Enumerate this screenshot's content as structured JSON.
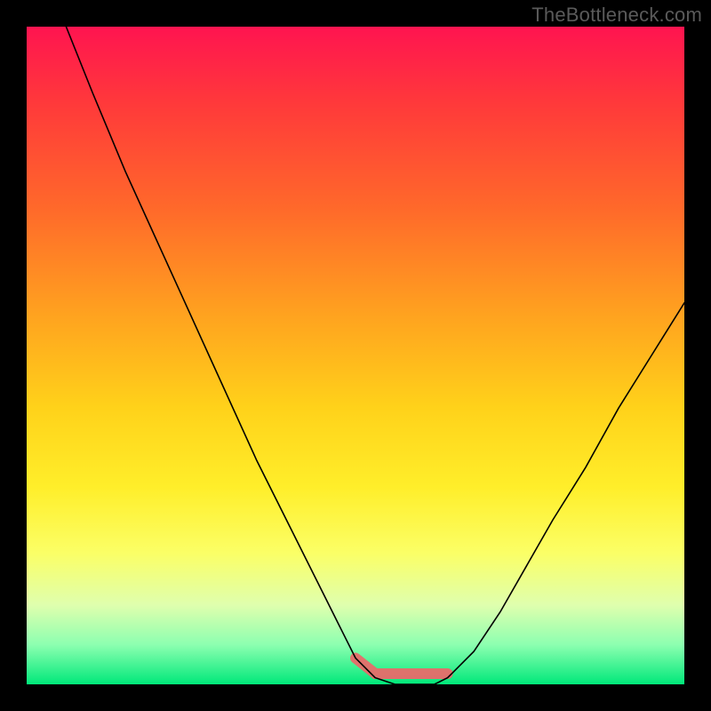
{
  "watermark": "TheBottleneck.com",
  "chart_data": {
    "type": "line",
    "title": "",
    "xlabel": "",
    "ylabel": "",
    "xlim": [
      0,
      100
    ],
    "ylim": [
      0,
      100
    ],
    "x": [
      6,
      10,
      15,
      20,
      25,
      30,
      35,
      40,
      45,
      48,
      50,
      53,
      56,
      59,
      62,
      64,
      68,
      72,
      76,
      80,
      85,
      90,
      95,
      100
    ],
    "values": [
      100,
      90,
      78,
      67,
      56,
      45,
      34,
      24,
      14,
      8,
      4,
      1,
      0,
      0,
      0,
      1,
      5,
      11,
      18,
      25,
      33,
      42,
      50,
      58
    ],
    "series": [
      {
        "name": "bottleneck-curve",
        "color": "#000000"
      },
      {
        "name": "optimal-range-highlight",
        "color": "#e86a6a",
        "x_range": [
          50,
          64
        ]
      }
    ],
    "background_gradient": [
      {
        "stop": 0.0,
        "color": "#ff1450"
      },
      {
        "stop": 0.5,
        "color": "#ffd21a"
      },
      {
        "stop": 0.8,
        "color": "#fbff66"
      },
      {
        "stop": 1.0,
        "color": "#00e87a"
      }
    ]
  }
}
